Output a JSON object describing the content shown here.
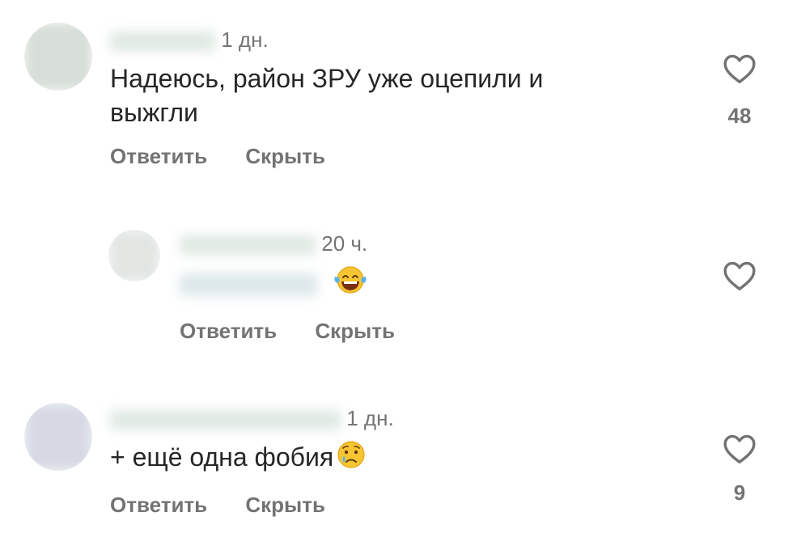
{
  "comments": [
    {
      "time": "1 дн.",
      "text_lines": [
        "Надеюсь, район ЗРУ уже оцепили и",
        "выжгли"
      ],
      "reply_label": "Ответить",
      "hide_label": "Скрыть",
      "likes": "48",
      "like_icon": "heart-outline-icon"
    },
    {
      "time": "20 ч.",
      "emoji": "face-with-tears-of-joy",
      "reply_label": "Ответить",
      "hide_label": "Скрыть",
      "like_icon": "heart-outline-icon"
    },
    {
      "time": "1 дн.",
      "text": "+ ещё одна фобия",
      "emoji": "crying-face",
      "reply_label": "Ответить",
      "hide_label": "Скрыть",
      "likes": "9",
      "like_icon": "heart-outline-icon"
    }
  ],
  "colors": {
    "text": "#262626",
    "secondary": "#737373",
    "blur_mask": "#dfe9e3",
    "mention_blue": "#b9d8ee"
  }
}
